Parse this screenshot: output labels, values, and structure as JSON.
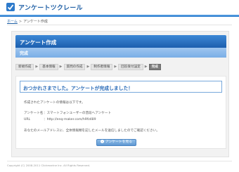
{
  "header": {
    "logo_text": "アンケートツクレール",
    "logo_icon": "enketo-logo-icon"
  },
  "breadcrumb": {
    "home": "ホーム",
    "separator": ">",
    "current": "アンケート作成"
  },
  "panel": {
    "title": "アンケート作成",
    "subtitle": "完成"
  },
  "steps": [
    {
      "label": "新規作成",
      "active": false
    },
    {
      "label": "基本情報",
      "active": false
    },
    {
      "label": "質問の作成",
      "active": false
    },
    {
      "label": "制作者情報",
      "active": false
    },
    {
      "label": "回答受付設定",
      "active": false
    },
    {
      "label": "完成",
      "active": true
    }
  ],
  "step_arrow": "▶",
  "content": {
    "success_message": "おつかれさまでした。アンケートが完成しました！",
    "info_intro": "作成されたアンケートの情報は以下です。",
    "name_label": "アンケート名",
    "name_value": "：スマートフォンユーザーの普段へアンケート",
    "url_label": "URL",
    "url_value": "：http://enq-maker.com/h9fz489",
    "mail_notice": "あなたのメールアドレスに、全体情報類を記したメールを送信しましたのでご確認ください。",
    "view_button": "アンケートを見る"
  },
  "footer": {
    "copyright": "Copyright (C) 2008-2011 Clickmarine Inc. All Rights Reserved."
  },
  "colors": {
    "brand_blue": "#1f5fa5",
    "title_bar": "#2d72c2",
    "message_blue": "#2b6cb8"
  }
}
